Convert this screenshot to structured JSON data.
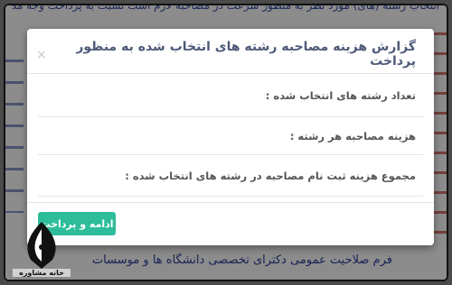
{
  "background": {
    "top_text": "انتخاب رشته (های) مورد نظر به منظور سرعت در مصاحبه لازم است نسبت به پرداخت وجه مصاحبه",
    "bottom_link": "فرم صلاحیت عمومی دکترای تخصصی دانشگاه ها و موسسات"
  },
  "modal": {
    "title": "گزارش هزینه مصاحبه رشته های انتخاب شده به منظور پرداخت",
    "close": "×",
    "rows": [
      {
        "label": "تعداد رشته های انتخاب شده :"
      },
      {
        "label": "هزینه مصاحبه هر رشته :"
      },
      {
        "label": "مجموع هزینه ثبت نام مصاحبه در رشته های انتخاب شده :"
      }
    ],
    "continue_button": "ادامه و پرداخت"
  },
  "logo": {
    "caption": "خانه مشاوره"
  },
  "colors": {
    "overlay": "rgba(0,0,0,0.45)",
    "title": "#4d5a78",
    "button": "#2ebd9a",
    "background_text": "#3a4fa3"
  }
}
